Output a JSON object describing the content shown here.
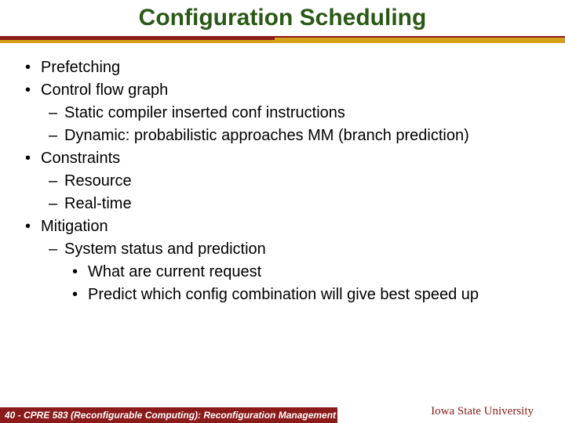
{
  "title": "Configuration Scheduling",
  "bullets": {
    "b1": "Prefetching",
    "b2": "Control flow graph",
    "b2_1": "Static compiler inserted conf instructions",
    "b2_2": "Dynamic: probabilistic approaches MM (branch prediction)",
    "b3": "Constraints",
    "b3_1": "Resource",
    "b3_2": "Real-time",
    "b4": "Mitigation",
    "b4_1": "System status and prediction",
    "b4_1_1": "What are current request",
    "b4_1_2": "Predict which config combination will give best speed up"
  },
  "footer": {
    "left": "40 - CPRE 583 (Reconfigurable Computing):  Reconfiguration Management",
    "right": "Iowa State University"
  },
  "colors": {
    "title": "#2a5916",
    "accent_red": "#8b1a1a",
    "accent_gold": "#d4a017"
  }
}
